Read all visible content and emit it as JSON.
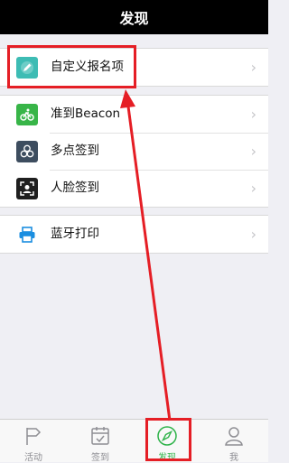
{
  "header": {
    "title": "发现"
  },
  "groups": {
    "first": {
      "items": [
        {
          "label": "自定义报名项",
          "icon": "pencil-icon",
          "color": "#3dbcb4"
        }
      ]
    },
    "second": {
      "items": [
        {
          "label": "准到Beacon",
          "icon": "bicycle-icon",
          "color": "#38b548"
        },
        {
          "label": "多点签到",
          "icon": "multipoint-icon",
          "color": "#3d4d5f"
        },
        {
          "label": "人脸签到",
          "icon": "face-scan-icon",
          "color": "#1f1f1f"
        }
      ]
    },
    "third": {
      "items": [
        {
          "label": "蓝牙打印",
          "icon": "printer-icon",
          "color": "#1a8ee0"
        }
      ]
    }
  },
  "tabbar": {
    "tabs": [
      {
        "label": "活动",
        "icon": "flag-icon"
      },
      {
        "label": "签到",
        "icon": "calendar-check-icon"
      },
      {
        "label": "发现",
        "icon": "compass-icon",
        "active": true
      },
      {
        "label": "我",
        "icon": "person-icon"
      }
    ]
  },
  "annotation": {
    "color": "#e51e25"
  }
}
